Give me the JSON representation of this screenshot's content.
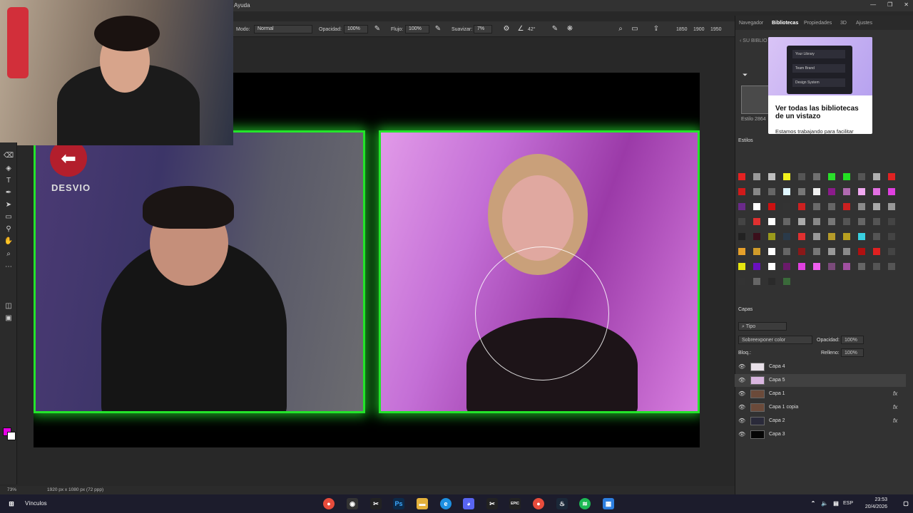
{
  "menu": {
    "visible_item": "Ayuda"
  },
  "options_bar": {
    "mode_label": "Modo:",
    "mode_value": "Normal",
    "opacity_label": "Opacidad:",
    "opacity_value": "100%",
    "flow_label": "Flujo:",
    "flow_value": "100%",
    "smooth_label": "Suavizar:",
    "smooth_value": "7%",
    "angle_value": "42°",
    "ruler_ticks": [
      "1850",
      "1900",
      "1950"
    ]
  },
  "panels": {
    "top_tabs": [
      "Navegador",
      "Bibliotecas",
      "Propiedades",
      "3D",
      "Ajustes"
    ],
    "active_top_tab": "Bibliotecas",
    "library_back": "SU BIBLIO",
    "style_label": "Estilo 2864",
    "library_popup": {
      "menu_items": [
        "Your Library",
        "Team Brand",
        "Design System"
      ],
      "title": "Ver todas las bibliotecas de un vistazo",
      "description": "Estamos trabajando para facilitar"
    },
    "styles_title": "Estilos",
    "layers": {
      "title": "Capas",
      "filter_value": "Tipo",
      "blend_mode": "Sobreexponer color",
      "opacity_label": "Opacidad:",
      "opacity_value": "100%",
      "lock_label": "Bloq.:",
      "fill_label": "Relleno:",
      "fill_value": "100%",
      "items": [
        {
          "name": "Capa 4",
          "fx": ""
        },
        {
          "name": "Capa 5",
          "fx": ""
        },
        {
          "name": "Capa 1",
          "fx": "fx"
        },
        {
          "name": "Capa 1 copia",
          "fx": "fx"
        },
        {
          "name": "Capa 2",
          "fx": "fx"
        },
        {
          "name": "Capa 3",
          "fx": ""
        }
      ],
      "selected_index": 1
    }
  },
  "canvas": {
    "sign_text": "DESVIO",
    "frame_color": "#23e42a"
  },
  "status_bar": {
    "zoom": "73%",
    "doc_info": "1920 px x 1080 px (72 ppp)"
  },
  "taskbar": {
    "label": "Vínculos",
    "lang": "ESP",
    "time": "23:53",
    "date": "20/4/2026",
    "epic_label": "EPIC"
  },
  "colors": {
    "foreground": "#e600e6",
    "background": "#ffffff",
    "accent_green": "#23e42a"
  }
}
